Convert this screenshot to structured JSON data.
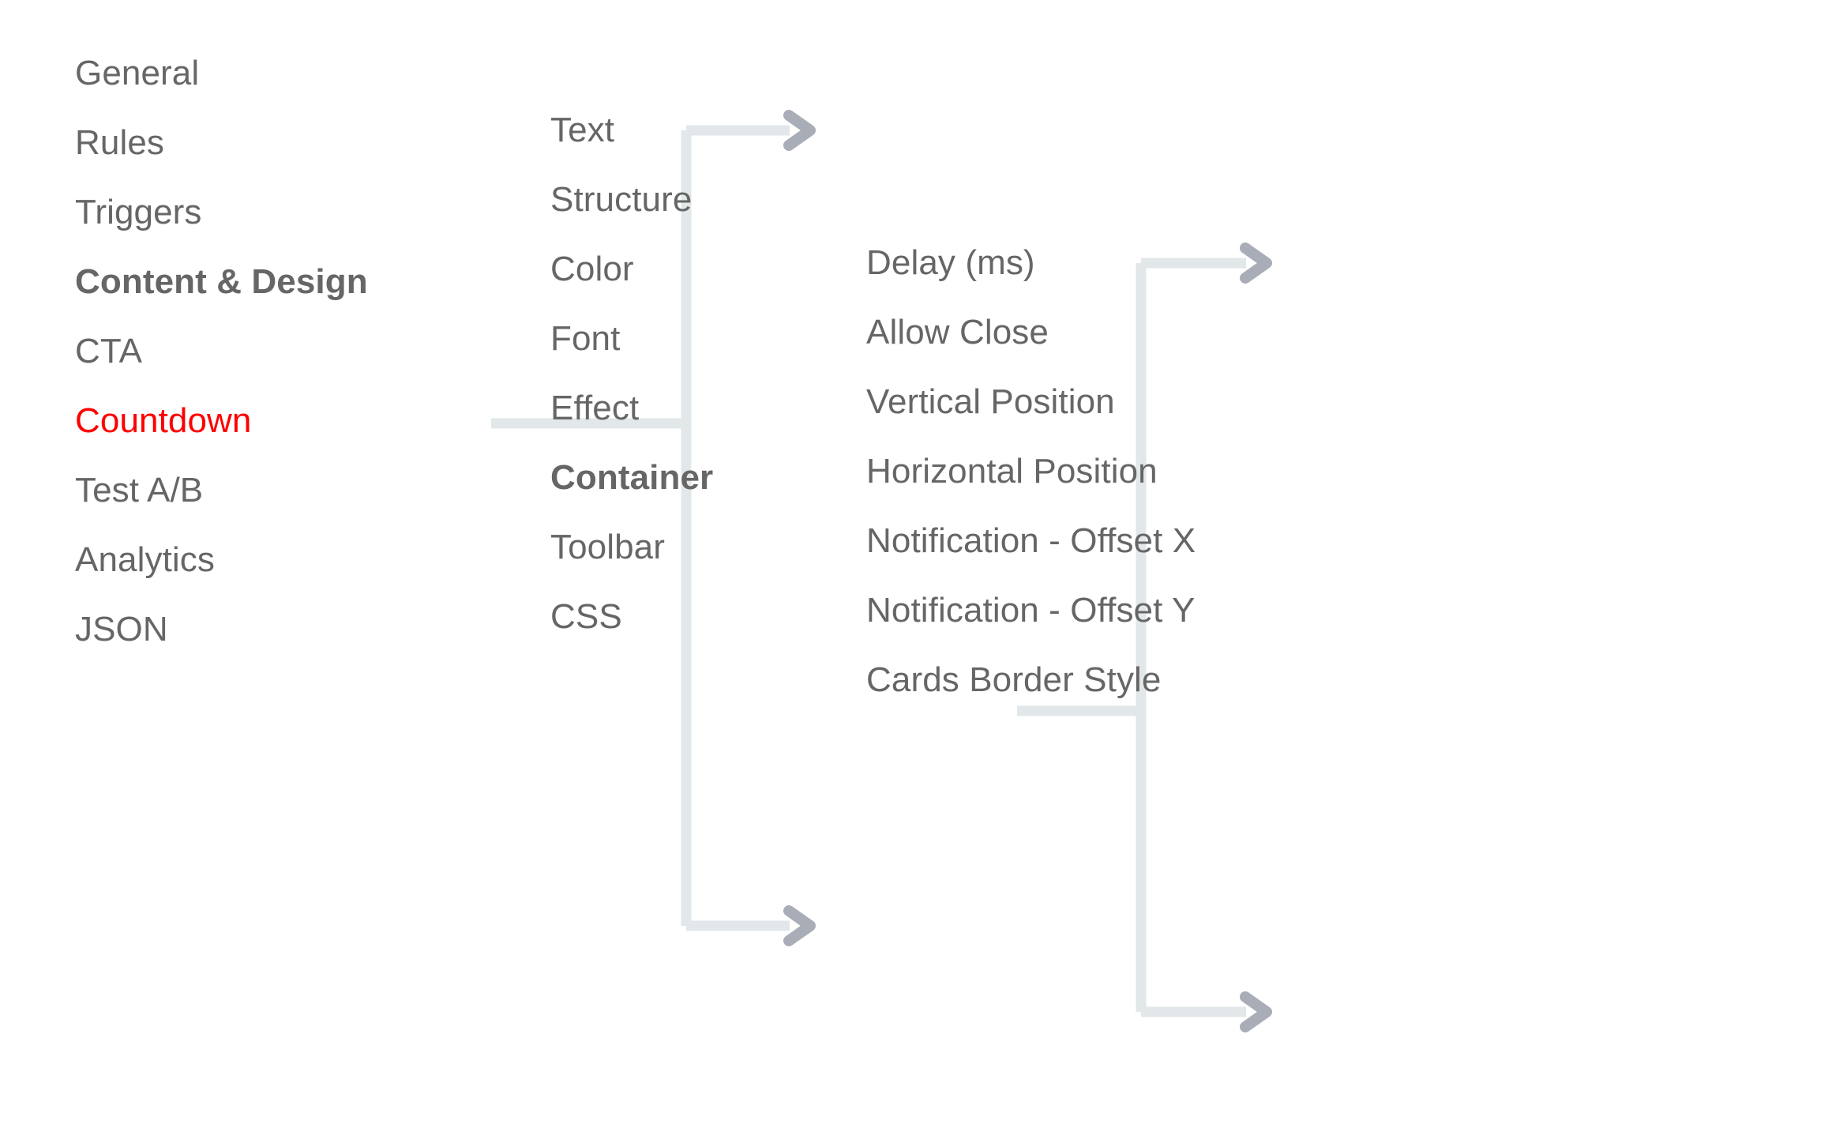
{
  "diagram": {
    "title": "Countdown Settings Navigation Hierarchy",
    "background_color": "#ffffff",
    "text_color": "#666666",
    "active_color": "#ff0000",
    "connector_color": "#e2e7ea",
    "arrow_color": "#a8adb8"
  },
  "columns": [
    {
      "name": "primary-nav",
      "items": [
        {
          "label": "General",
          "style": "normal"
        },
        {
          "label": "Rules",
          "style": "normal"
        },
        {
          "label": "Triggers",
          "style": "normal"
        },
        {
          "label": "Content & Design",
          "style": "bold"
        },
        {
          "label": "CTA",
          "style": "normal"
        },
        {
          "label": "Countdown",
          "style": "active"
        },
        {
          "label": "Test A/B",
          "style": "normal"
        },
        {
          "label": "Analytics",
          "style": "normal"
        },
        {
          "label": "JSON",
          "style": "normal"
        }
      ]
    },
    {
      "name": "content-design-subnav",
      "items": [
        {
          "label": "Text",
          "style": "normal"
        },
        {
          "label": "Structure",
          "style": "normal"
        },
        {
          "label": "Color",
          "style": "normal"
        },
        {
          "label": "Font",
          "style": "normal"
        },
        {
          "label": "Effect",
          "style": "normal"
        },
        {
          "label": "Container",
          "style": "bold"
        },
        {
          "label": "Toolbar",
          "style": "normal"
        },
        {
          "label": "CSS",
          "style": "normal"
        }
      ]
    },
    {
      "name": "container-settings",
      "items": [
        {
          "label": "Delay (ms)",
          "style": "normal"
        },
        {
          "label": "Allow Close",
          "style": "normal"
        },
        {
          "label": "Vertical Position",
          "style": "normal"
        },
        {
          "label": "Horizontal Position",
          "style": "normal"
        },
        {
          "label": "Notification - Offset X",
          "style": "normal"
        },
        {
          "label": "Notification - Offset Y",
          "style": "normal"
        },
        {
          "label": "Cards Border Style",
          "style": "normal"
        }
      ]
    }
  ],
  "connectors": [
    {
      "name": "content-design-to-subnav",
      "from": "Content & Design",
      "to_first": "Text",
      "to_last": "CSS"
    },
    {
      "name": "container-to-settings",
      "from": "Container",
      "to_first": "Delay (ms)",
      "to_last": "Cards Border Style"
    }
  ]
}
